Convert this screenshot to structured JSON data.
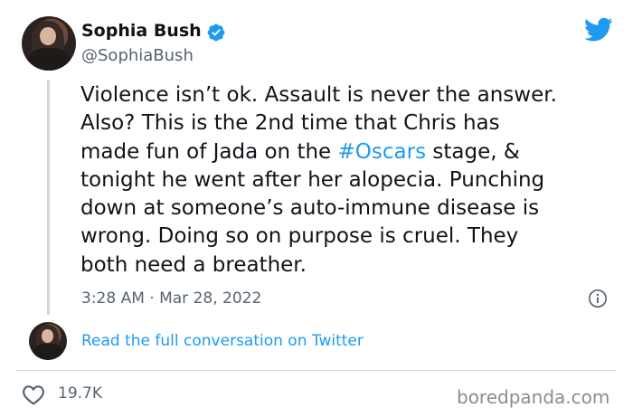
{
  "author": {
    "display_name": "Sophia Bush",
    "handle": "@SophiaBush",
    "verified": true,
    "avatar_icon": "avatar-photo"
  },
  "tweet": {
    "lines": [
      [
        "Violence isn’t ok. Assault is never the answer."
      ],
      [
        "Also? This is the 2nd time that Chris has"
      ],
      [
        "made fun of Jada on the ",
        "#Oscars",
        " stage, &"
      ],
      [
        "tonight he went after her alopecia. Punching"
      ],
      [
        "down at someone’s auto-immune disease is"
      ],
      [
        "wrong. Doing so on purpose is cruel. They"
      ],
      [
        "both need a breather."
      ]
    ],
    "timestamp": "3:28 AM · Mar 28, 2022"
  },
  "actions": {
    "read_conversation": "Read the full conversation on Twitter",
    "like_count": "19.7K"
  },
  "watermark": "boredpanda.com",
  "icons": {
    "brand": "twitter-bird-icon",
    "verified": "verified-badge-icon",
    "info": "info-icon",
    "like": "heart-icon"
  },
  "colors": {
    "accent": "#1d9bf0",
    "text": "#0f1419",
    "muted": "#536471",
    "border": "#cfd9de"
  }
}
